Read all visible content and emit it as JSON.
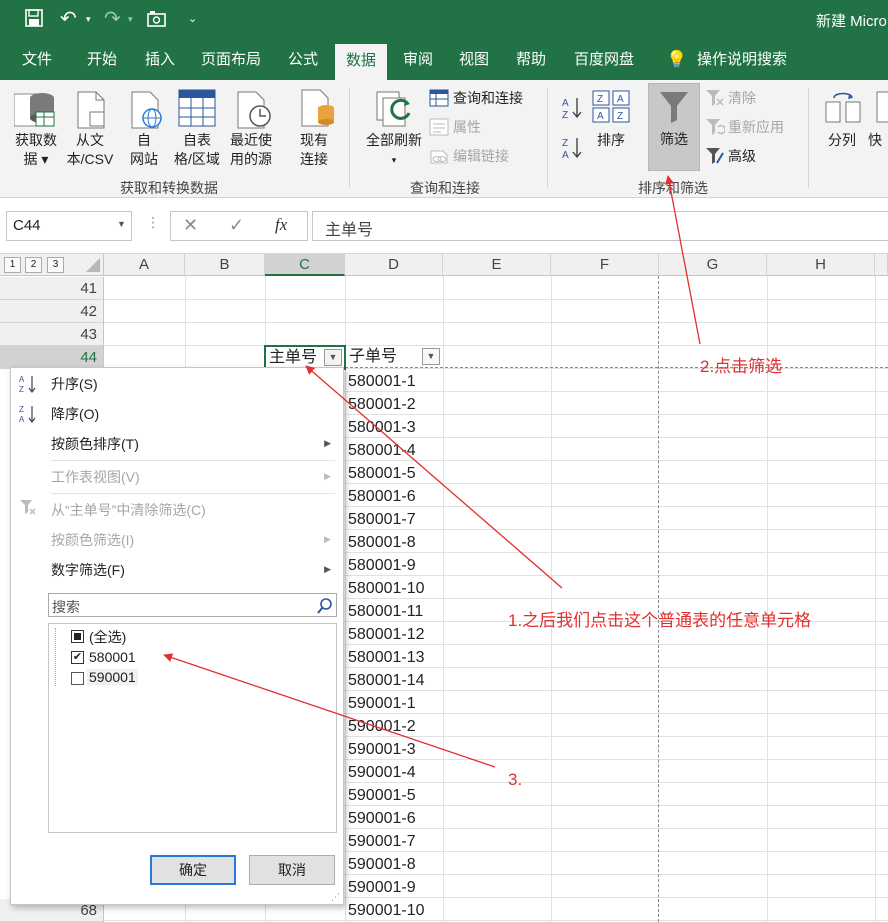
{
  "window": {
    "title": "新建 Micro"
  },
  "ribbon_tabs": [
    "文件",
    "开始",
    "插入",
    "页面布局",
    "公式",
    "数据",
    "审阅",
    "视图",
    "帮助",
    "百度网盘",
    "操作说明搜索"
  ],
  "active_tab": "数据",
  "ribbon": {
    "get_data": "获取数\n据 ▾",
    "from_csv": "从文\n本/CSV",
    "from_web": "自\n网站",
    "from_table": "自表\n格/区域",
    "recent_sources": "最近使\n用的源",
    "existing_conn": "现有\n连接",
    "group1": "获取和转换数据",
    "refresh_all": "全部刷新",
    "refresh_arrow": "▾",
    "query_conn": "查询和连接",
    "properties": "属性",
    "edit_links": "编辑链接",
    "group2": "查询和连接",
    "sort": "排序",
    "filter": "筛选",
    "clear": "清除",
    "reapply": "重新应用",
    "advanced": "高级",
    "group3": "排序和筛选",
    "split": "分列",
    "quick": "快"
  },
  "formula_bar": {
    "name_box": "C44",
    "cancel": "✕",
    "enter": "✓",
    "fx": "fx",
    "content": "主单号"
  },
  "outline_levels": [
    "1",
    "2",
    "3"
  ],
  "columns": [
    "A",
    "B",
    "C",
    "D",
    "E",
    "F",
    "G",
    "H"
  ],
  "rows": [
    "41",
    "42",
    "43",
    "44"
  ],
  "last_row": "68",
  "header_cells": {
    "c44": "主单号",
    "d44": "子单号"
  },
  "d_values": [
    "580001-1",
    "580001-2",
    "580001-3",
    "580001-4",
    "580001-5",
    "580001-6",
    "580001-7",
    "580001-8",
    "580001-9",
    "580001-10",
    "580001-11",
    "580001-12",
    "580001-13",
    "580001-14",
    "590001-1",
    "590001-2",
    "590001-3",
    "590001-4",
    "590001-5",
    "590001-6",
    "590001-7",
    "590001-8",
    "590001-9",
    "590001-10"
  ],
  "filter_menu": {
    "sort_asc": "升序(S)",
    "sort_desc": "降序(O)",
    "sort_by_color": "按颜色排序(T)",
    "sheet_view": "工作表视图(V)",
    "clear_filter": "从“主单号”中清除筛选(C)",
    "filter_by_color": "按颜色筛选(I)",
    "number_filters": "数字筛选(F)",
    "search_placeholder": "搜索",
    "items": [
      {
        "label": "(全选)",
        "state": "partial"
      },
      {
        "label": "580001",
        "state": "checked"
      },
      {
        "label": "590001",
        "state": "unchecked"
      }
    ],
    "ok": "确定",
    "cancel": "取消"
  },
  "annotations": {
    "a1": "1.之后我们点击这个普通表的任意单元格",
    "a2": "2.点击筛选",
    "a3": "3."
  },
  "colors": {
    "excel_green": "#217346",
    "annotation_red": "#e0302f"
  }
}
